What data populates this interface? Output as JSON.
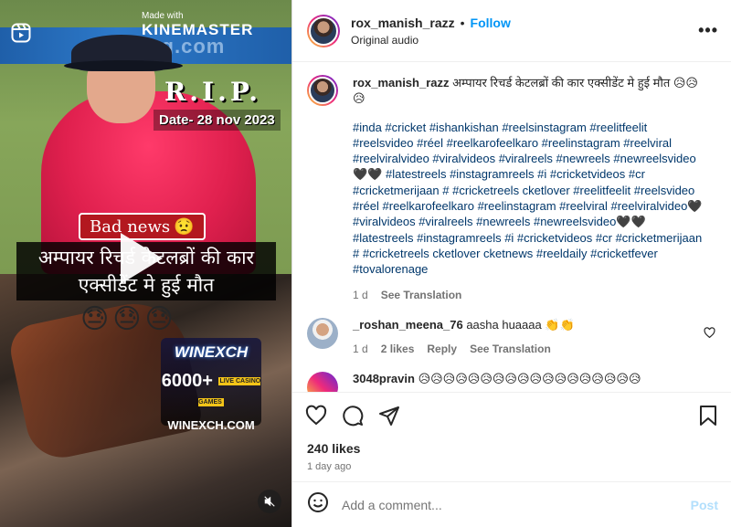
{
  "media": {
    "watermark_prefix": "Made with",
    "watermark_brand": "KINEMASTER",
    "banner_text": "Booking.com",
    "rip_text": "R.I.P.",
    "date_text": "Date- 28 nov 2023",
    "bad_news_text": "Bad news",
    "bad_news_emoji": "😟",
    "headline": "अम्पायर रिचर्ड केटलब्रों की कार एक्सीडेंट मे हुई मौत",
    "emojis": "😓😓😓",
    "ad": {
      "brand": "WINEXCH",
      "promo": "6000+",
      "promo_tag": "LIVE CASINO GAMES",
      "site": "WINEXCH.COM"
    }
  },
  "header": {
    "username": "rox_manish_razz",
    "separator": "•",
    "follow_label": "Follow",
    "audio": "Original audio",
    "more": "•••"
  },
  "caption": {
    "username": "rox_manish_razz",
    "text": "अम्पायर रिचर्ड केटलब्रों की कार एक्सीडेंट मे हुई मौत 😥😥😥",
    "hashtags": "#inda #cricket #ishankishan #reelsinstagram #reelitfeelit #reelsvideo #réel #reelkarofeelkaro #reelinstagram #reelviral #reelviralvideo #viralvideos #viralreels #newreels #newreelsvideo 🖤🖤 #latestreels #instagramreels #i #cricketvideos #cr #cricketmerijaan # #cricketreels cketlover #reelitfeelit #reelsvideo #réel #reelkarofeelkaro #reelinstagram #reelviral #reelviralvideo🖤 #viralvideos #viralreels #newreels #newreelsvideo🖤🖤 #latestreels #instagramreels #i #cricketvideos #cr #cricketmerijaan # #cricketreels cketlover cketnews #reeldaily #cricketfever #tovalorenage",
    "age": "1 d",
    "see_translation": "See Translation"
  },
  "comments": [
    {
      "username": "_roshan_meena_76",
      "text": "aasha huaaaa 👏👏",
      "age": "1 d",
      "likes": "2 likes",
      "reply": "Reply",
      "see_translation": "See Translation"
    },
    {
      "username": "3048pravin",
      "text": "😥😥😥😥😥😥😥😥😥😥😥😥😥😥😥😥😥😥"
    }
  ],
  "likes": "240 likes",
  "posted": "1 day ago",
  "add_comment": {
    "placeholder": "Add a comment...",
    "post_label": "Post"
  },
  "colors": {
    "link": "#0095f6",
    "hashtag": "#00376b",
    "muted": "#737373"
  }
}
